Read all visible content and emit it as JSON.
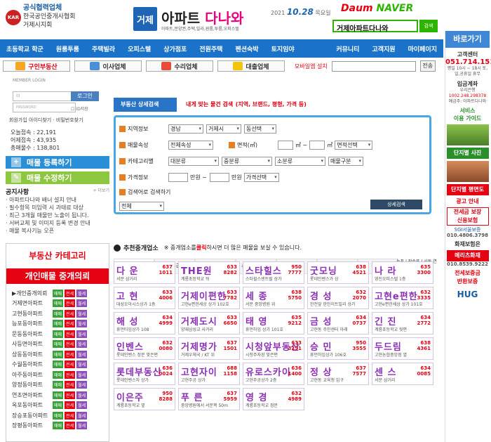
{
  "header": {
    "assoc_logo": "KAR",
    "assoc_line1": "공식협력업체",
    "assoc_line2": "한국공인중개사협회",
    "assoc_line3": "거제시지회",
    "site_logo_box": "거제",
    "site_name_a": "아파트",
    "site_name_b": "다나와",
    "site_tagline": "아파트,분양권,주택,빌라,원룸,투룸,오피스텔",
    "date_year": "2021",
    "date_md": "10.28",
    "date_day": "목요일",
    "portal_daum": "Daum",
    "portal_naver": "NAVER",
    "search_text": "거제아파트다나와",
    "search_btn": "검색"
  },
  "nav": [
    "초등학교 학군",
    "원룸투룸",
    "주택빌라",
    "오피스텔",
    "상가점포",
    "전원주택",
    "펜션숙박",
    "토지임야",
    "커뮤니티",
    "고객지원",
    "마이페이지"
  ],
  "subnav": {
    "items": [
      {
        "label": "구인부동산",
        "color": "#e50012"
      },
      {
        "label": "이사업체",
        "color": "#333333"
      },
      {
        "label": "수리업체",
        "color": "#333333"
      },
      {
        "label": "대출업체",
        "color": "#333333"
      }
    ],
    "mobile_setup": "모바일앱 설치",
    "search_btn": "전송"
  },
  "login": {
    "title": "MEMBER LOGIN",
    "id_placeholder": "ID",
    "pw_placeholder": "PASSWORD",
    "login_btn": "로그인",
    "save_id": "ID저장",
    "join": "회원가입",
    "find": "아이디찾기 · 비밀번호찾기"
  },
  "visit": {
    "today": "오늘접속 : 22,191",
    "yesterday": "어제접속 : 43,935",
    "total": "총매물수 : 138,801"
  },
  "left_buttons": {
    "register": "매물 등록하기",
    "edit": "매물 수정하기"
  },
  "notice": {
    "title": "공지사항",
    "more": "+ 더보기",
    "items": [
      "아파트다나와 배너 설치 안내",
      "필수항목 미입력 시 과태료 대상",
      "최근 3개월 매물만 노출이 됩니다.",
      "서버교체 및 이미지 등록 변경 안내",
      "매물 복사기능 오픈"
    ]
  },
  "category": {
    "title": "부동산 카테고리",
    "sub": "개인매물 중개의뢰",
    "rows": [
      "▶개인중개의뢰",
      "거제면아파트",
      "고현동아파트",
      "능포동아파트",
      "문동동아파트",
      "사등면아파트",
      "상동동아파트",
      "수월동아파트",
      "아주동아파트",
      "양정동아파트",
      "연초면아파트",
      "옥포동아파트",
      "장승포동아파트",
      "장평동아파트"
    ],
    "tag1": "매매",
    "tag2": "전세",
    "tag3": "월세"
  },
  "search_panel": {
    "tab": "부동산 상세검색",
    "title": "내게 맞는 물건 검색",
    "title_sub": "(지역, 브랜드, 평형, 가격 등)",
    "region_label": "지역정보",
    "region_vals": [
      "경남",
      "거제시",
      "동선택"
    ],
    "attr_label": "매물속성",
    "attr_val": "전체속성",
    "area_label": "면적(㎡)",
    "area_unit": "㎡ ~",
    "area_unit2": "㎡",
    "area_sel": "면적선택",
    "cat_label": "카테고리별",
    "cat_vals": [
      "대분류",
      "중분류",
      "소분류",
      "매물구분"
    ],
    "price_label": "가격정보",
    "price_unit1": "만원 ~",
    "price_unit2": "만원",
    "price_sel": "가격선택",
    "keyword_label": "검색어로 검색하기",
    "keyword_sel": "전체",
    "go_btn": "상세검색"
  },
  "agency": {
    "title": "추천중개업소",
    "hint_pre": "※ 중개업소를",
    "hint_click": "클릭",
    "hint_post": "하시면 더 많은 매물을 보실 수 있습니다.",
    "tabs": [
      "고 현",
      "중 곡",
      "상동 | 문동",
      "수월 | 양정",
      "아 주",
      "옥 포",
      "장 평"
    ],
    "side": "능포 | 장승포 | 사동 연초 | 장목 | 지세포",
    "cards": [
      {
        "name": "다 운",
        "num": "637\n1011",
        "desc": "서문 삼거리"
      },
      {
        "name": "THE원",
        "num": "633\n8282",
        "desc": "계룡초등학교 뒤"
      },
      {
        "name": "스타힐스",
        "num": "950\n7777",
        "desc": "스타힐스센트럴 상가"
      },
      {
        "name": "굿모닝",
        "num": "638\n4521",
        "desc": "롯데인벤스가 상"
      },
      {
        "name": "나 라",
        "num": "635\n3300",
        "desc": "영진오피스텔 1층"
      },
      {
        "name": "고 현",
        "num": "633\n4006",
        "desc": "대성오아시스상가 1층"
      },
      {
        "name": "거제이편한",
        "num": "633\n7782",
        "desc": "고현e편한세상 상가 102호"
      },
      {
        "name": "세 종",
        "num": "638\n5750",
        "desc": "서문 중앙병원 위"
      },
      {
        "name": "경 성",
        "num": "632\n2070",
        "desc": "한전앞 한인이트빌리 상가"
      },
      {
        "name": "고현e편한",
        "num": "632\n3335",
        "desc": "고현e편한세상 상가 101호"
      },
      {
        "name": "해 성",
        "num": "634\n4999",
        "desc": "휴먼타임상가 108"
      },
      {
        "name": "거제도시",
        "num": "633\n6650",
        "desc": "양재삼성교 사거리"
      },
      {
        "name": "태 영",
        "num": "635\n9212",
        "desc": "휴먼하임 상가 101호"
      },
      {
        "name": "금 성",
        "num": "634\n0737",
        "desc": "고현동 주민센터 아래"
      },
      {
        "name": "긴 진",
        "num": "634\n2772",
        "desc": "계룡초등학교 뒷편"
      },
      {
        "name": "인벤스",
        "num": "632\n0080",
        "desc": "롯데인벤스 정문 맞은편"
      },
      {
        "name": "거제명가",
        "num": "637\n1501",
        "desc": "거제우체국 / KT 위"
      },
      {
        "name": "시청앞부동산",
        "num": "633\n3251",
        "desc": "시청주차장 맞은편"
      },
      {
        "name": "승 민",
        "num": "950\n3555",
        "desc": "휴먼하임상가 106호"
      },
      {
        "name": "두드림",
        "num": "638\n4361",
        "desc": "고현농협중앙점 옆"
      },
      {
        "name": "롯데부동산",
        "num": "636\n0024",
        "desc": "롯데인벤스자 상가"
      },
      {
        "name": "고현자이",
        "num": "688\n1158",
        "desc": "고현주공 상가"
      },
      {
        "name": "유로스카이",
        "num": "636\n1400",
        "desc": "고현주공상가 2층"
      },
      {
        "name": "정 상",
        "num": "637\n7577",
        "desc": "고현동 교육청 입구"
      },
      {
        "name": "센 스",
        "num": "634\n0085",
        "desc": "서문 삼거리"
      },
      {
        "name": "이은주",
        "num": "950\n8288",
        "desc": "계룡초등학교 옆"
      },
      {
        "name": "푸 른",
        "num": "637\n5959",
        "desc": "중앙병원에서 서문쪽 50m"
      },
      {
        "name": "영 경",
        "num": "632\n4989",
        "desc": "계룡초등학교 정문"
      }
    ]
  },
  "right": {
    "title": "바로가기",
    "sec1": "고객센터",
    "phone": "051.714.1511",
    "hours": "평일 10시 ~ 18시\n토,일,공휴일 휴무",
    "sec2": "입금계좌",
    "bank": "우리은행",
    "account": "1002.248.298378",
    "holder": "예금주: 아파트다나와",
    "service": "서비스\n이용 가이드",
    "complex": "단지별 사진",
    "plan": "단지별 평면도",
    "ad": "광고 안내",
    "insure": "전세금 보장\n신용보험",
    "sgi_phone": "010.4806.3798",
    "fire": "화재보험은",
    "meritz": "메리츠화재",
    "fire_phone": "010.8539.9222",
    "deposit": "전세보증금\n반환보증",
    "hug": "HUG"
  }
}
